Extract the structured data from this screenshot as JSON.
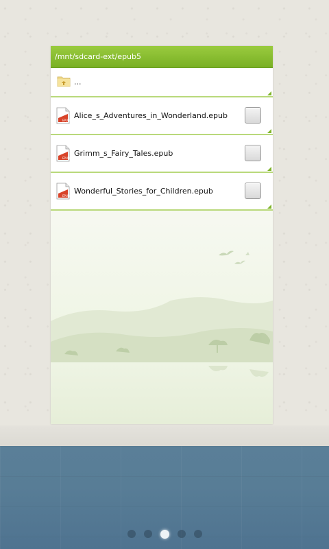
{
  "browser": {
    "path": "/mnt/sdcard-ext/epub5",
    "parent_label": "...",
    "files": [
      {
        "name": "Alice_s_Adventures_in_Wonderland.epub",
        "checked": false,
        "icon": "epub-file-icon"
      },
      {
        "name": "Grimm_s_Fairy_Tales.epub",
        "checked": false,
        "icon": "epub-file-icon"
      },
      {
        "name": "Wonderful_Stories_for_Children.epub",
        "checked": false,
        "icon": "epub-file-icon"
      }
    ]
  },
  "pager": {
    "pages": 5,
    "active_page": 3
  },
  "colors": {
    "header_green": "#8ac032",
    "divider_green": "#b9d97b",
    "bottom_bar": "#587d96"
  }
}
